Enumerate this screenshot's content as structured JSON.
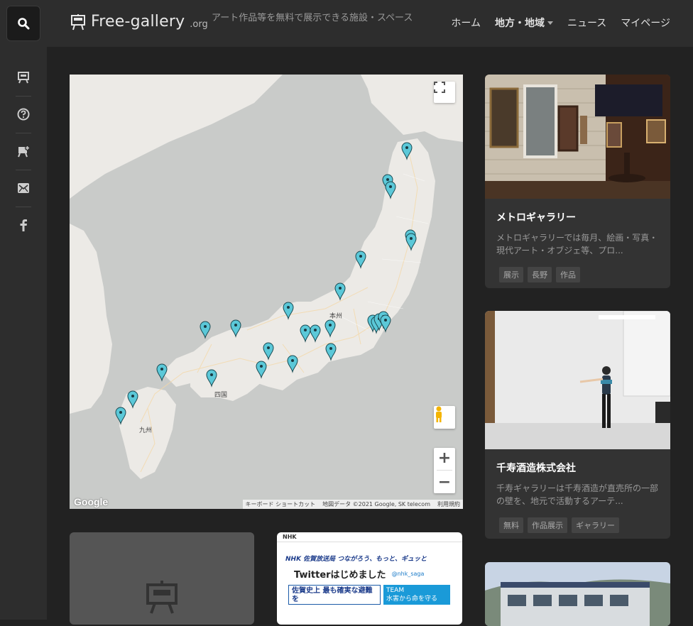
{
  "header": {
    "logo_text": "Free-gallery",
    "logo_tld": ".org",
    "tagline": "アート作品等を無料で展示できる施設・スペース",
    "nav": [
      {
        "label": "ホーム"
      },
      {
        "label": "地方・地域"
      },
      {
        "label": "ニュース"
      },
      {
        "label": "マイページ"
      }
    ]
  },
  "map": {
    "labels": {
      "honshu": "本州",
      "shikoku": "四国",
      "kyushu": "九州"
    },
    "zoom_in": "+",
    "zoom_out": "−",
    "google": "Google",
    "attribution": {
      "shortcuts": "キーボード ショートカット",
      "data": "地図データ ©2021 Google, SK telecom",
      "terms": "利用規約"
    }
  },
  "cards": [
    {
      "title": "メトロギャラリー",
      "desc": "メトロギャラリーでは毎月、絵画・写真・現代アート・オブジェ等、プロ...",
      "tags": [
        "展示",
        "長野",
        "作品"
      ]
    },
    {
      "title": "千寿酒造株式会社",
      "desc": "千寿ギャラリーは千寿酒造が直売所の一部の壁を、地元で活動するアーテ...",
      "tags": [
        "無料",
        "作品展示",
        "ギャラリー"
      ]
    }
  ],
  "thumb_nhk": {
    "brand": "NHK",
    "headline1": "NHK 佐賀放送局 つながろう、もっと、ギュッと",
    "headline2": "Twitterはじめました",
    "handle": "@nhk_saga",
    "banner_left": "佐賀史上 最も確実な避難を",
    "banner_right_top": "TEAM",
    "banner_right_bottom": "水害から命を守る"
  },
  "colors": {
    "accent_pin": "#5bc8d8",
    "header_bg": "#2d2d2d",
    "card_bg": "#333333"
  }
}
